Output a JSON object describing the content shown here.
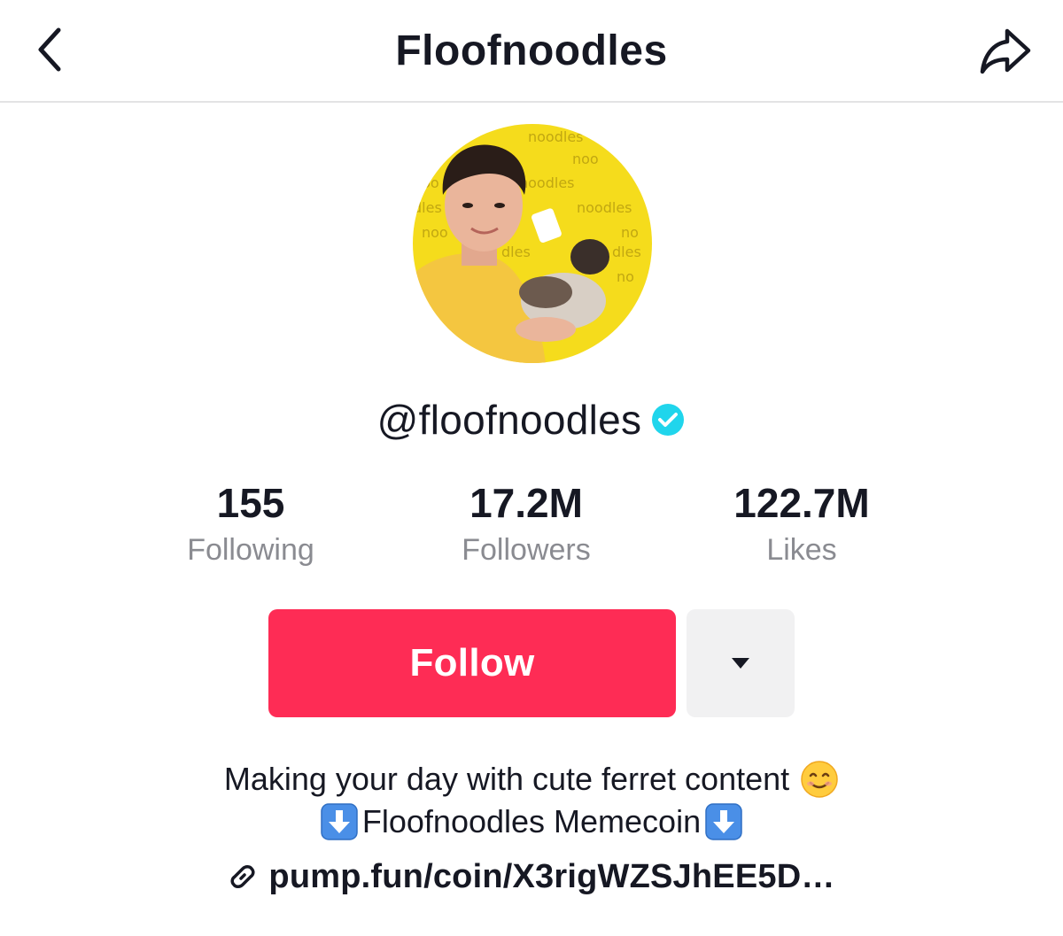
{
  "header": {
    "title": "Floofnoodles",
    "back_icon": "chevron-left-icon",
    "share_icon": "share-arrow-icon"
  },
  "profile": {
    "username": "@floofnoodles",
    "verified": true,
    "avatar_colors": {
      "background": "#f5dc1c",
      "shirt": "#f4c640"
    }
  },
  "stats": [
    {
      "value": "155",
      "label": "Following"
    },
    {
      "value": "17.2M",
      "label": "Followers"
    },
    {
      "value": "122.7M",
      "label": "Likes"
    }
  ],
  "actions": {
    "follow_label": "Follow",
    "more_icon": "caret-down-icon"
  },
  "bio": {
    "line1": "Making your day with cute ferret content",
    "line1_emoji": "smiling-face-icon",
    "line2": "Floofnoodles Memecoin",
    "line2_emoji": "down-arrow-box-icon"
  },
  "link": {
    "text": "pump.fun/coin/X3rigWZSJhEE5D…",
    "icon": "link-icon"
  },
  "colors": {
    "accent": "#fe2c55",
    "verified": "#20d5ec",
    "text_primary": "#161823",
    "text_secondary": "#8a8b91",
    "button_secondary_bg": "#f1f1f2"
  }
}
